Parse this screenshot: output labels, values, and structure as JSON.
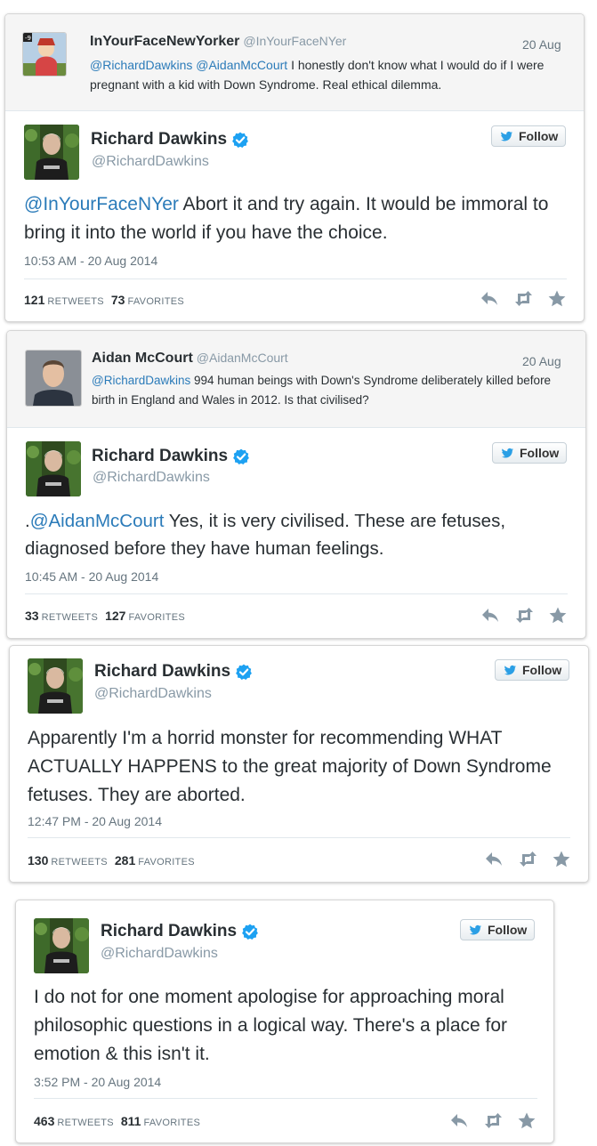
{
  "cards": [
    {
      "reply": {
        "name": "InYourFaceNewYorker",
        "handle": "@InYourFaceNYer",
        "date": "20 Aug",
        "mention1": "@RichardDawkins",
        "mention2": "@AidanMcCourt",
        "text": "I honestly don't know what I would do if I were pregnant with a kid with Down Syndrome. Real ethical dilemma."
      },
      "tweet": {
        "name": "Richard Dawkins",
        "handle": "@RichardDawkins",
        "follow": "Follow",
        "mention": "@InYourFaceNYer",
        "text": " Abort it and try again. It would be immoral to bring it into the world if you have the choice.",
        "timestamp": "10:53 AM - 20 Aug 2014",
        "retweets": "121",
        "retweets_label": "RETWEETS",
        "favorites": "73",
        "favorites_label": "FAVORITES"
      }
    },
    {
      "reply": {
        "name": "Aidan McCourt",
        "handle": "@AidanMcCourt",
        "date": "20 Aug",
        "mention1": "@RichardDawkins",
        "text": "994 human beings with Down's Syndrome deliberately killed before birth in England and Wales in 2012. Is that civilised?"
      },
      "tweet": {
        "name": "Richard Dawkins",
        "handle": "@RichardDawkins",
        "follow": "Follow",
        "prefix": ".",
        "mention": "@AidanMcCourt",
        "text": " Yes, it is very civilised. These are fetuses, diagnosed before they have human feelings.",
        "timestamp": "10:45 AM - 20 Aug 2014",
        "retweets": "33",
        "retweets_label": "RETWEETS",
        "favorites": "127",
        "favorites_label": "FAVORITES"
      }
    },
    {
      "tweet": {
        "name": "Richard Dawkins",
        "handle": "@RichardDawkins",
        "follow": "Follow",
        "text": "Apparently I'm a horrid monster for recommending WHAT ACTUALLY HAPPENS to the great majority of Down Syndrome fetuses. They are aborted.",
        "timestamp": "12:47 PM - 20 Aug 2014",
        "retweets": "130",
        "retweets_label": "RETWEETS",
        "favorites": "281",
        "favorites_label": "FAVORITES"
      }
    },
    {
      "tweet": {
        "name": "Richard Dawkins",
        "handle": "@RichardDawkins",
        "follow": "Follow",
        "text": "I do not for one moment apologise for approaching moral philosophic questions in a logical way. There's a place for emotion & this isn't it.",
        "timestamp": "3:52 PM - 20 Aug 2014",
        "retweets": "463",
        "retweets_label": "RETWEETS",
        "favorites": "811",
        "favorites_label": "FAVORITES"
      }
    }
  ],
  "colors": {
    "link": "#2b7bb9",
    "verified": "#1da1f2",
    "icon": "#8899a6"
  }
}
